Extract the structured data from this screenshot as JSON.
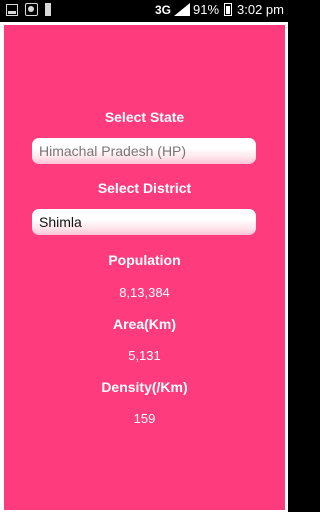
{
  "status_bar": {
    "network": "3G",
    "battery_percent": "91%",
    "time": "3:02 pm",
    "icons": [
      "image-icon",
      "camera-icon",
      "notification-icon",
      "signal-icon",
      "battery-icon"
    ]
  },
  "form": {
    "state_label": "Select State",
    "state_value": "Himachal Pradesh (HP)",
    "district_label": "Select District",
    "district_value": "Shimla"
  },
  "stats": {
    "population_label": "Population",
    "population_value": "8,13,384",
    "area_label": "Area(Km)",
    "area_value": "5,131",
    "density_label": "Density(/Km)",
    "density_value": "159"
  },
  "colors": {
    "panel_background": "#fe3b7c",
    "outer_background": "#ffffff",
    "text": "#ffffff"
  }
}
